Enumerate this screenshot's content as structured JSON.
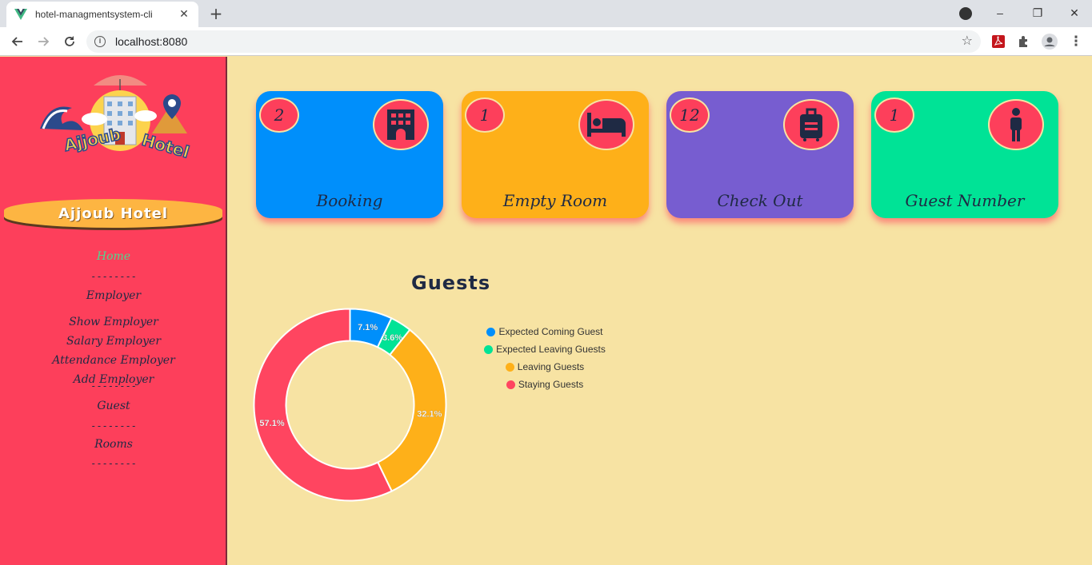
{
  "browser": {
    "tab_title": "hotel-managmentsystem-cli",
    "url": "localhost:8080",
    "tab_close": "✕",
    "new_tab": "+",
    "minimize": "–",
    "restore": "❐",
    "close": "✕"
  },
  "sidebar": {
    "brand": "Ajjoub Hotel",
    "logo_text": "Ajjoub Hotel",
    "items": [
      {
        "label": "Home",
        "active": true
      },
      {
        "label": "Employer"
      },
      {
        "label": "Show Employer"
      },
      {
        "label": "Salary Employer"
      },
      {
        "label": "Attendance Employer"
      },
      {
        "label": "Add Employer"
      },
      {
        "label": "Guest"
      },
      {
        "label": "Rooms"
      }
    ],
    "separator": "--------"
  },
  "cards": [
    {
      "count": "2",
      "label": "Booking",
      "color": "#008ffb",
      "icon": "building-icon"
    },
    {
      "count": "1",
      "label": "Empty Room",
      "color": "#feb019",
      "icon": "bed-icon"
    },
    {
      "count": "12",
      "label": "Check Out",
      "color": "#775dd0",
      "icon": "suitcase-icon"
    },
    {
      "count": "1",
      "label": "Guest Number",
      "color": "#00e396",
      "icon": "person-icon"
    }
  ],
  "chart_data": {
    "type": "pie",
    "title": "Guests",
    "donut": true,
    "legend_position": "right",
    "labels": [
      "Expected Coming Guest",
      "Expected Leaving Guests",
      "Leaving Guests",
      "Staying Guests"
    ],
    "values": [
      7.1,
      3.6,
      32.1,
      57.1
    ],
    "data_labels": [
      "7.1%",
      "3.6%",
      "32.1%",
      "57.1%"
    ],
    "colors": [
      "#008ffb",
      "#00e396",
      "#feb019",
      "#ff4560"
    ]
  }
}
